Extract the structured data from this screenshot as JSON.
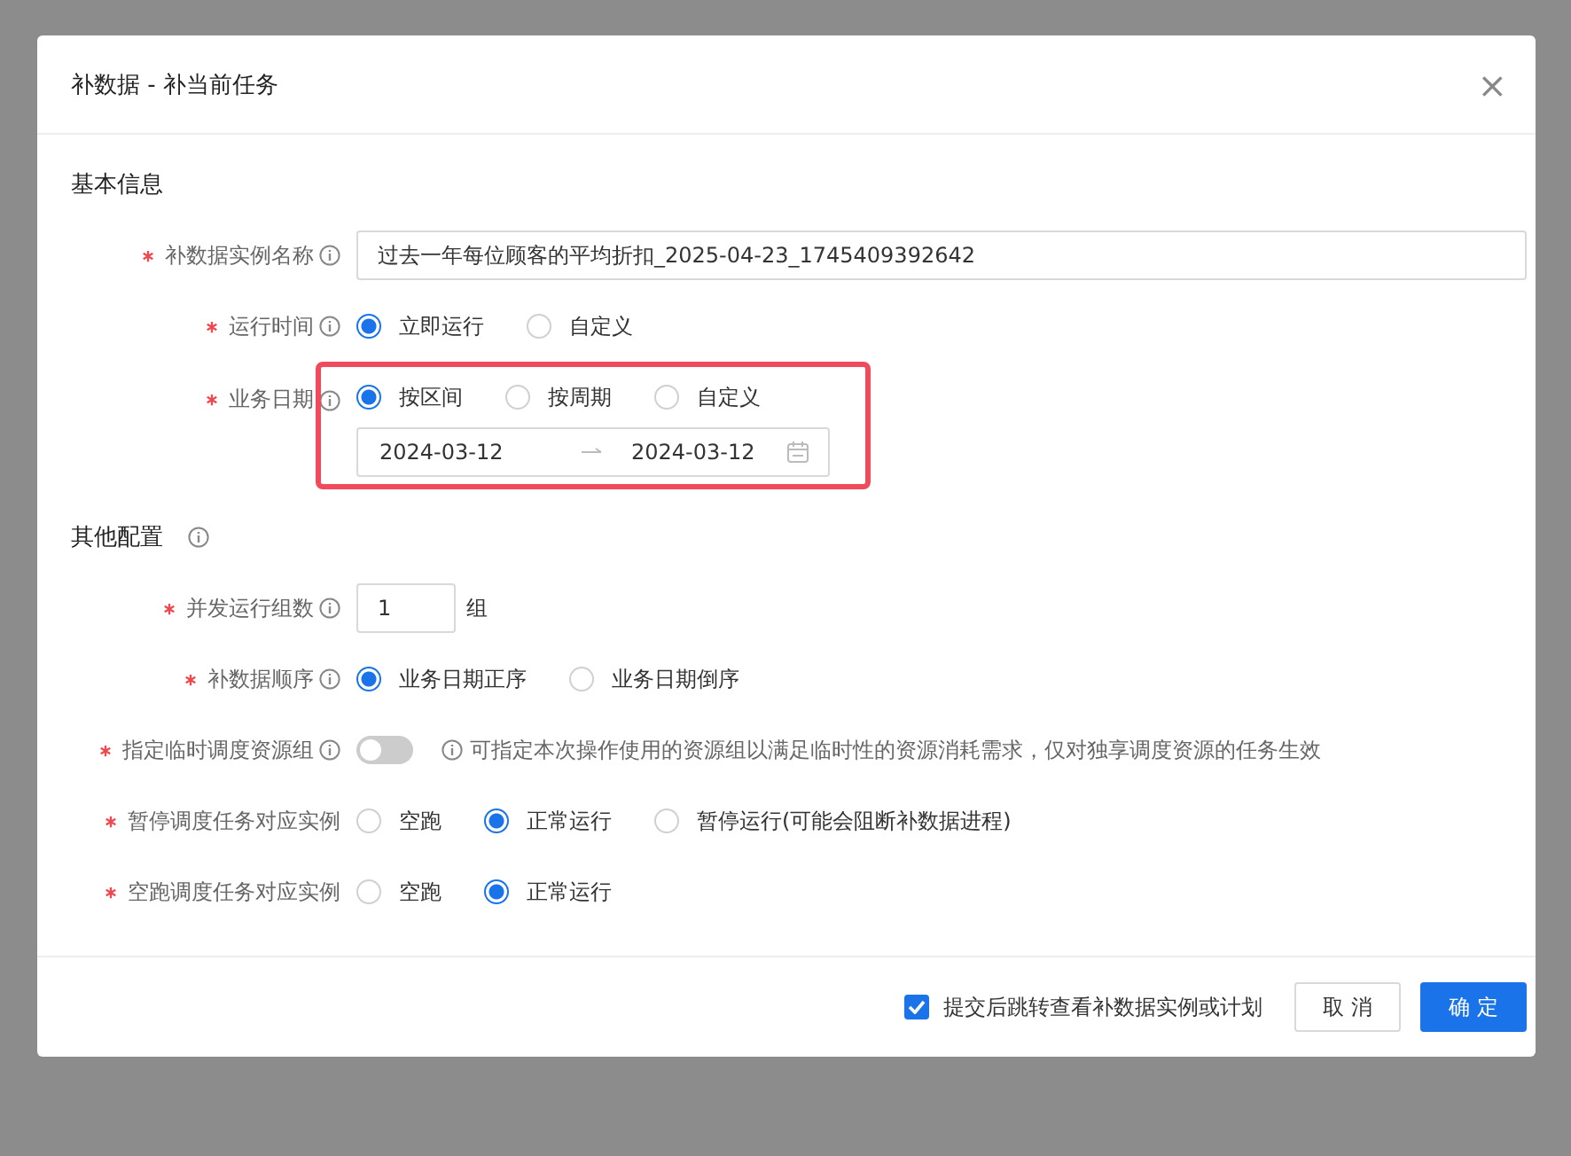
{
  "dialog": {
    "title": "补数据 - 补当前任务",
    "close": "×",
    "sections": [
      {
        "title": "基本信息",
        "info": false,
        "fields": [
          {
            "kind": "text",
            "label": "补数据实例名称",
            "required": true,
            "info": true,
            "value": "过去一年每位顾客的平均折扣_2025-04-23_1745409392642"
          },
          {
            "kind": "radio",
            "label": "运行时间",
            "required": true,
            "info": true,
            "options": [
              {
                "label": "立即运行",
                "selected": true
              },
              {
                "label": "自定义",
                "selected": false
              }
            ]
          },
          {
            "kind": "radio_daterange",
            "label": "业务日期",
            "required": true,
            "info": true,
            "highlighted": true,
            "options": [
              {
                "label": "按区间",
                "selected": true
              },
              {
                "label": "按周期",
                "selected": false
              },
              {
                "label": "自定义",
                "selected": false
              }
            ],
            "date_start": "2024-03-12",
            "date_end": "2024-03-12"
          }
        ]
      },
      {
        "title": "其他配置",
        "info": true,
        "fields": [
          {
            "kind": "number",
            "label": "并发运行组数",
            "required": true,
            "info": true,
            "value": "1",
            "unit": "组"
          },
          {
            "kind": "radio",
            "label": "补数据顺序",
            "required": true,
            "info": true,
            "options": [
              {
                "label": "业务日期正序",
                "selected": true
              },
              {
                "label": "业务日期倒序",
                "selected": false
              }
            ]
          },
          {
            "kind": "switch",
            "label": "指定临时调度资源组",
            "required": true,
            "info": true,
            "on": false,
            "hint": "可指定本次操作使用的资源组以满足临时性的资源消耗需求，仅对独享调度资源的任务生效"
          },
          {
            "kind": "radio",
            "label": "暂停调度任务对应实例",
            "required": true,
            "info": false,
            "options": [
              {
                "label": "空跑",
                "selected": false
              },
              {
                "label": "正常运行",
                "selected": true
              },
              {
                "label": "暂停运行(可能会阻断补数据进程)",
                "selected": false
              }
            ]
          },
          {
            "kind": "radio",
            "label": "空跑调度任务对应实例",
            "required": true,
            "info": false,
            "options": [
              {
                "label": "空跑",
                "selected": false
              },
              {
                "label": "正常运行",
                "selected": true
              }
            ]
          }
        ]
      }
    ],
    "footer": {
      "jump_checkbox": {
        "label": "提交后跳转查看补数据实例或计划",
        "checked": true
      },
      "buttons": [
        {
          "label": "取 消",
          "kind": "default"
        },
        {
          "label": "确 定",
          "kind": "primary"
        }
      ]
    }
  }
}
